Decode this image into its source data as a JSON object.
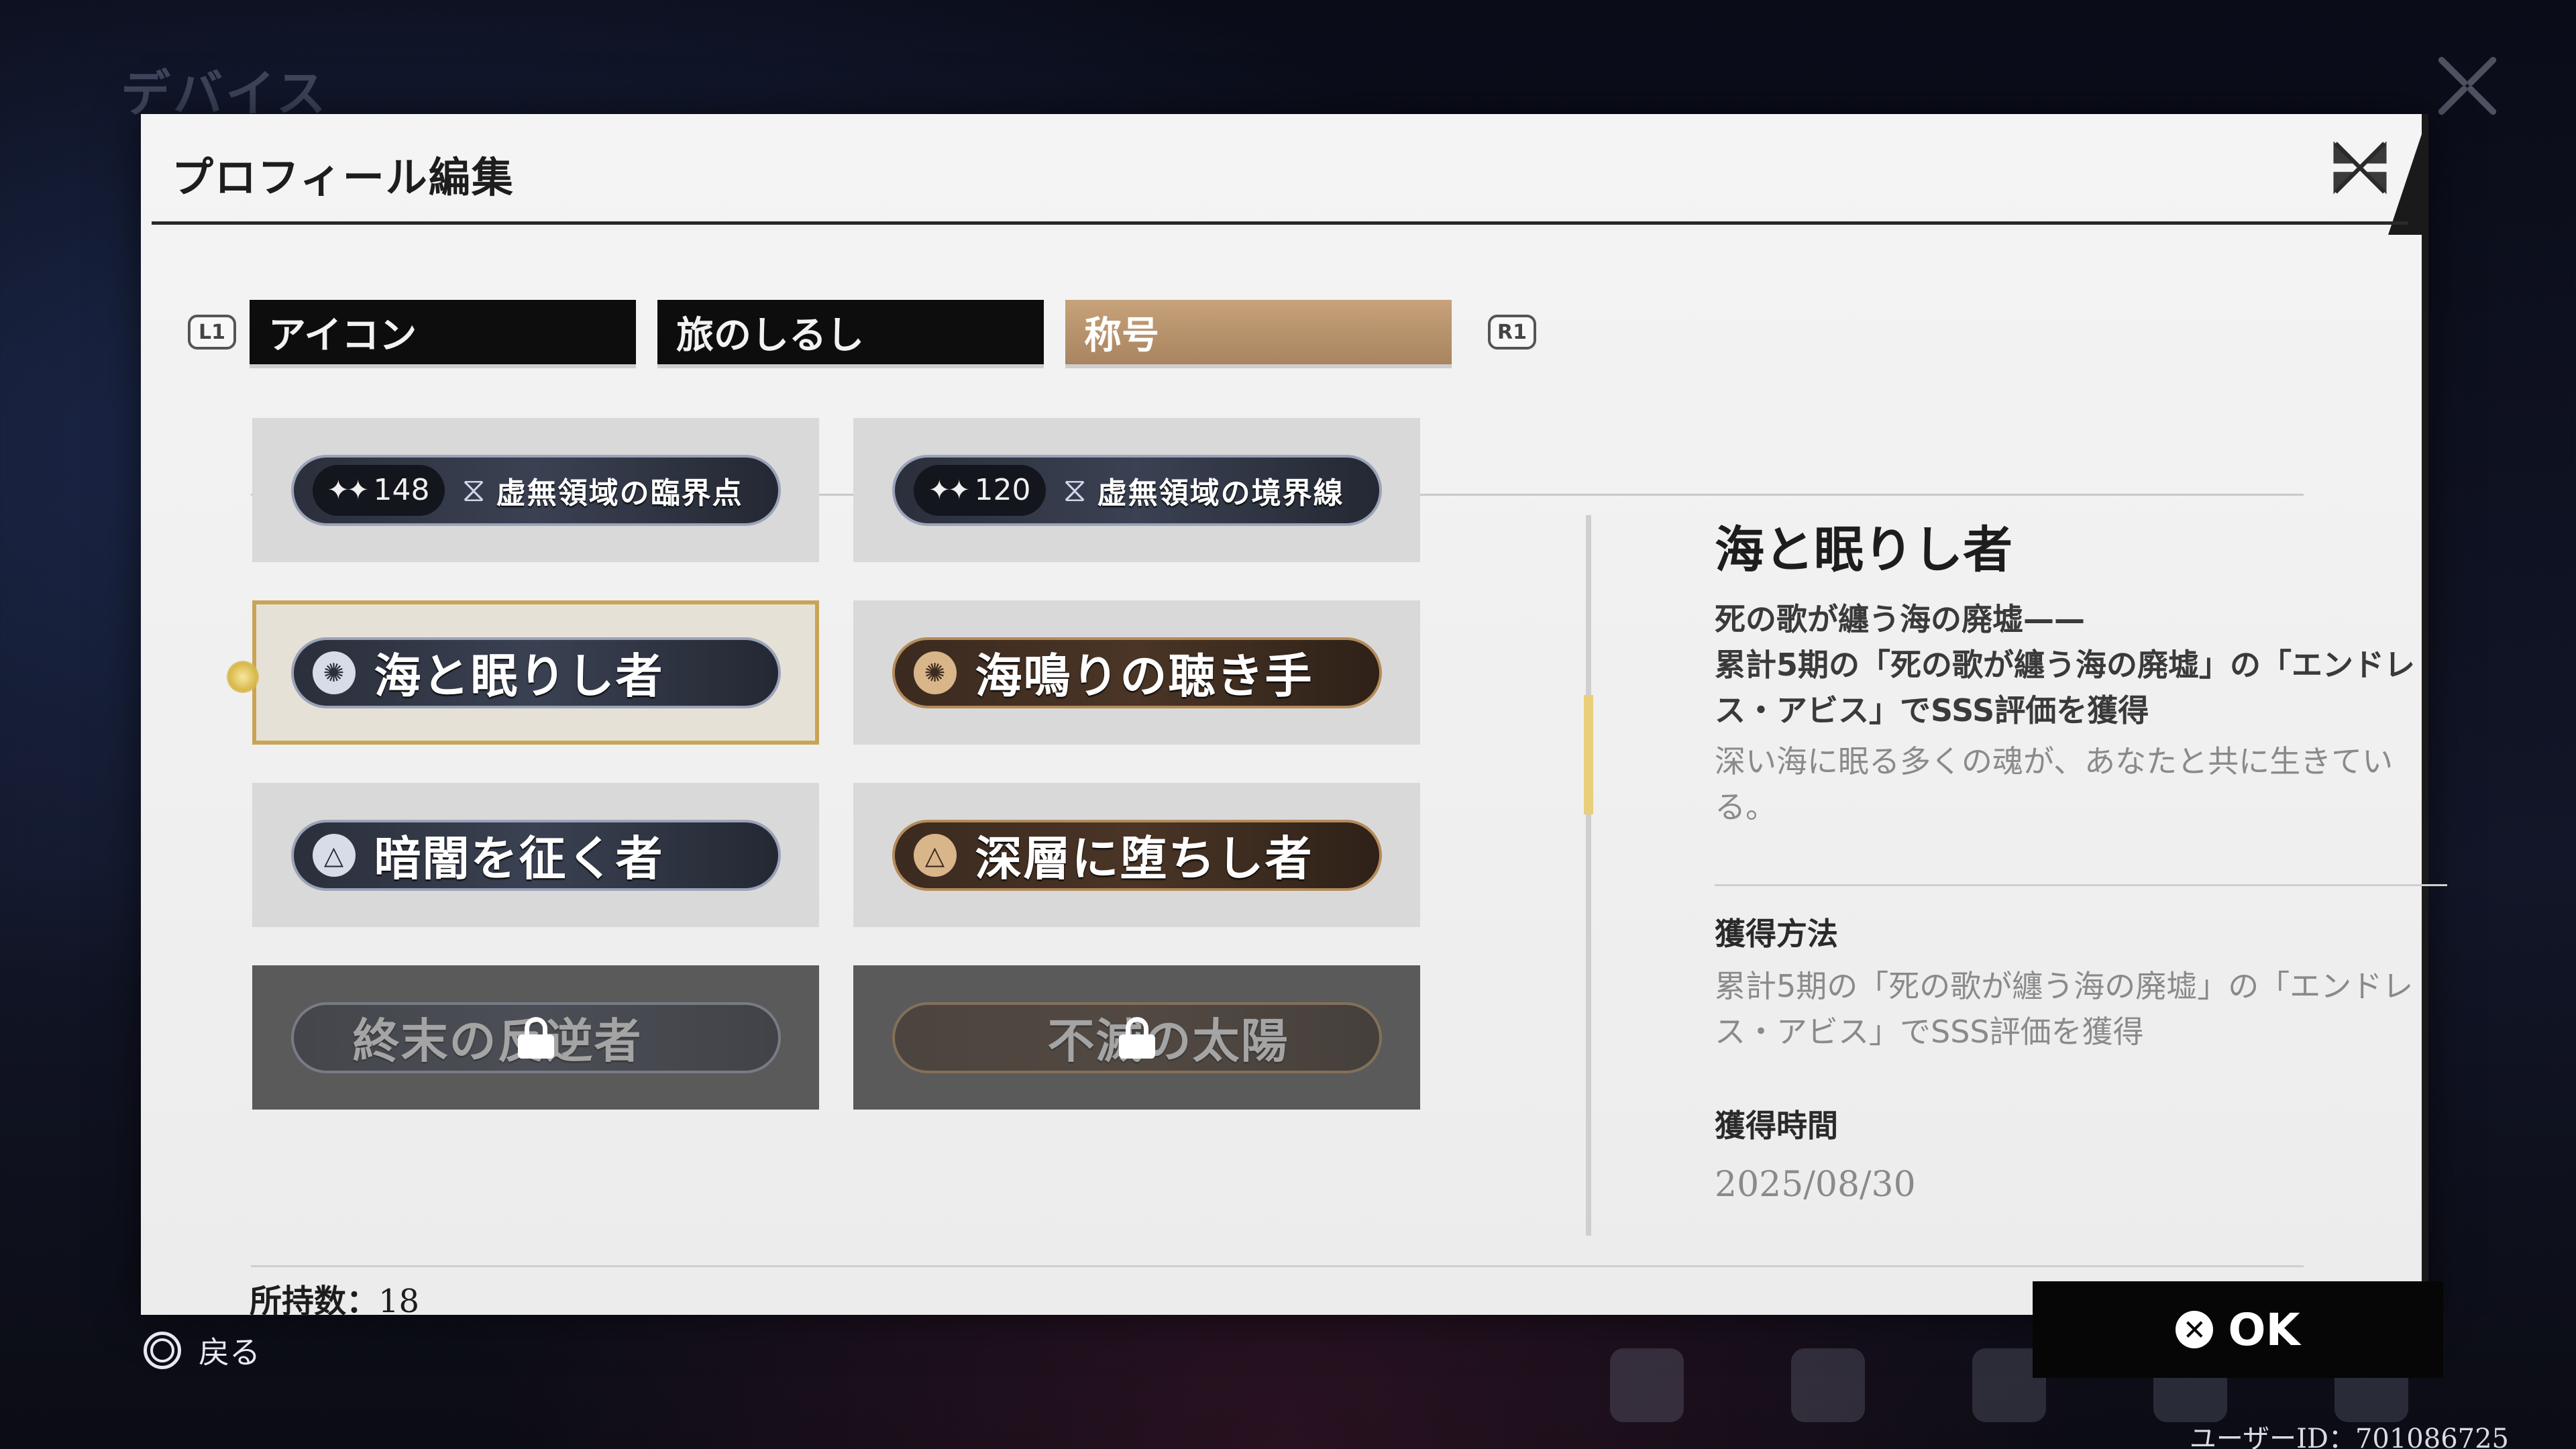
{
  "background": {
    "menu_title": "デバイス",
    "user_id": "ユーザーID：701086725",
    "back_label": "戻る"
  },
  "modal": {
    "title": "プロフィール編集",
    "shoulder_left": "L1",
    "shoulder_right": "R1",
    "tabs": [
      {
        "label": "アイコン",
        "active": false
      },
      {
        "label": "旅のしるし",
        "active": false
      },
      {
        "label": "称号",
        "active": true
      }
    ],
    "titles": [
      {
        "score": "148",
        "label": "虚無領域の臨界点",
        "style": "silver",
        "locked": false,
        "selected": false
      },
      {
        "score": "120",
        "label": "虚無領域の境界線",
        "style": "silver",
        "locked": false,
        "selected": false
      },
      {
        "label": "海と眠りし者",
        "style": "silver",
        "locked": false,
        "selected": true
      },
      {
        "label": "海鳴りの聴き手",
        "style": "bronze",
        "locked": false,
        "selected": false
      },
      {
        "label": "暗闇を征く者",
        "style": "silver",
        "locked": false,
        "selected": false
      },
      {
        "label": "深層に堕ちし者",
        "style": "bronze",
        "locked": false,
        "selected": false
      },
      {
        "label": "終末の反逆者",
        "style": "silver",
        "locked": true,
        "selected": false
      },
      {
        "label": "不滅の太陽",
        "style": "bronze",
        "locked": true,
        "selected": false
      }
    ],
    "owned_label": "所持数：",
    "owned_count": "18",
    "ok_label": "OK",
    "ok_icon": "✕",
    "detail": {
      "name": "海と眠りし者",
      "subtitle": "死の歌が纏う海の廃墟——",
      "condition": "累計5期の「死の歌が纏う海の廃墟」の「エンドレス・アビス」でSSS評価を獲得",
      "flavor": "深い海に眠る多くの魂が、あなたと共に生きている。",
      "how_label": "獲得方法",
      "how_value": "累計5期の「死の歌が纏う海の廃墟」の「エンドレス・アビス」でSSS評価を獲得",
      "time_label": "獲得時間",
      "time_value": "2025/08/30"
    }
  },
  "colors": {
    "tab_active": "#b8936c",
    "selected_border": "#c9a457",
    "ok_button": "#060606"
  }
}
